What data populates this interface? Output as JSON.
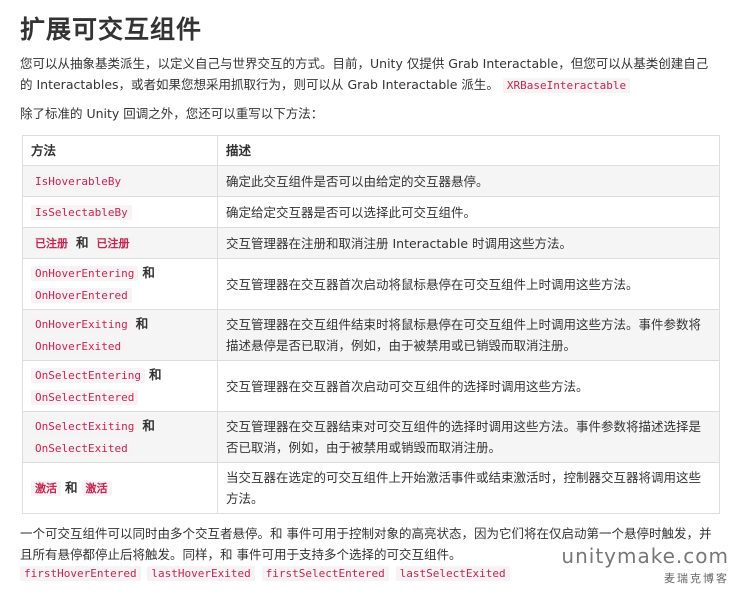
{
  "title": "扩展可交互组件",
  "intro": {
    "text1": "您可以从抽象基类派生，以定义自己与世界交互的方式。目前，Unity 仅提供 Grab Interactable，但您可以从基类创建自己的 Interactables，或者如果您想采用抓取行为，则可以从 Grab Interactable 派生。",
    "code": "XRBaseInteractable"
  },
  "intro2": "除了标准的 Unity 回调之外，您还可以重写以下方法：",
  "table": {
    "headers": [
      "方法",
      "描述"
    ],
    "rows": [
      {
        "m1": "IsHoverableBy",
        "and": "",
        "m2": "",
        "desc": "确定此交互组件是否可以由给定的交互器悬停。"
      },
      {
        "m1": "IsSelectableBy",
        "and": "",
        "m2": "",
        "desc": "确定给定交互器是否可以选择此可交互组件。"
      },
      {
        "m1": "已注册",
        "and": "和",
        "m2": "已注册",
        "desc": "交互管理器在注册和取消注册 Interactable 时调用这些方法。"
      },
      {
        "m1": "OnHoverEntering",
        "and": "和",
        "m2": "OnHoverEntered",
        "desc": "交互管理器在交互器首次启动将鼠标悬停在可交互组件上时调用这些方法。"
      },
      {
        "m1": "OnHoverExiting",
        "and": "和",
        "m2": "OnHoverExited",
        "desc": "交互管理器在交互组件结束时将鼠标悬停在可交互组件上时调用这些方法。事件参数将描述悬停是否已取消，例如，由于被禁用或已销毁而取消注册。"
      },
      {
        "m1": "OnSelectEntering",
        "and": "和",
        "m2": "OnSelectEntered",
        "desc": "交互管理器在交互器首次启动可交互组件的选择时调用这些方法。"
      },
      {
        "m1": "OnSelectExiting",
        "and": "和",
        "m2": "OnSelectExited",
        "desc": "交互管理器在交互器结束对可交互组件的选择时调用这些方法。事件参数将描述选择是否已取消，例如，由于被禁用或销毁而取消注册。"
      },
      {
        "m1": "激活",
        "and": "和",
        "m2": "激活",
        "desc": "当交互器在选定的可交互组件上开始激活事件或结束激活时，控制器交互器将调用这些方法。"
      }
    ]
  },
  "outro": "一个可交互组件可以同时由多个交互者悬停。和 事件可用于控制对象的高亮状态，因为它们将在仅启动第一个悬停时触发，并且所有悬停都停止后将触发。同样，和 事件可用于支持多个选择的可交互组件。",
  "codes": [
    "firstHoverEntered",
    "lastHoverExited",
    "firstSelectEntered",
    "lastSelectExited"
  ],
  "watermark": {
    "main": "unitymake.com",
    "sub": "麦瑞克博客"
  }
}
